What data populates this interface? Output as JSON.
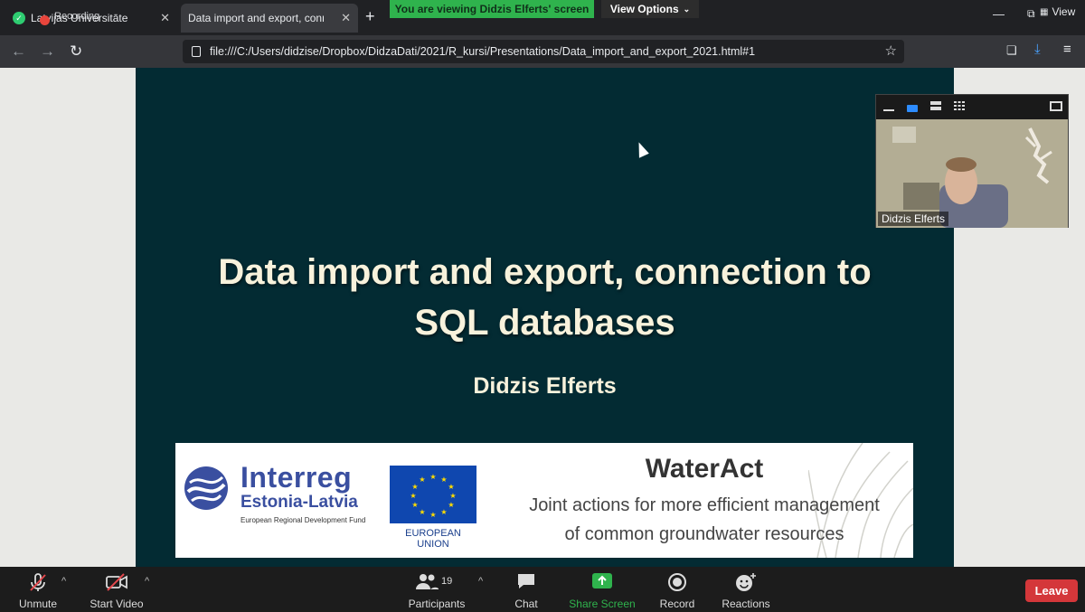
{
  "browser": {
    "tabs": [
      {
        "title": "Latvijas Universitāte",
        "overlay": "Recording"
      },
      {
        "title": "Data import and export, connection"
      }
    ],
    "url": "file:///C:/Users/didzise/Dropbox/DidzaDati/2021/R_kursi/Presentations/Data_import_and_export_2021.html#1"
  },
  "zoom": {
    "viewing_banner": "You are viewing Didzis Elferts' screen",
    "view_options": "View Options",
    "view_label": "View",
    "participant_name": "Didzis Elferts",
    "controls": {
      "unmute": "Unmute",
      "start_video": "Start Video",
      "participants": "Participants",
      "participants_count": "19",
      "chat": "Chat",
      "share_screen": "Share Screen",
      "record": "Record",
      "reactions": "Reactions",
      "leave": "Leave"
    },
    "colors": {
      "share_green": "#2fb34d",
      "leave_red": "#d4373a",
      "accent_blue": "#2d8cff"
    }
  },
  "slide": {
    "title_line1": "Data import and export, connection to",
    "title_line2": "SQL databases",
    "author": "Didzis Elferts",
    "banner": {
      "program_name": "Interreg",
      "program_region": "Estonia-Latvia",
      "program_fund": "European Regional Development Fund",
      "eu_label": "EUROPEAN UNION",
      "project_title": "WaterAct",
      "project_subtitle_line1": "Joint actions for more efficient management",
      "project_subtitle_line2": "of common groundwater resources"
    },
    "colors": {
      "background": "#032b33",
      "title": "#f8f2dc"
    }
  }
}
